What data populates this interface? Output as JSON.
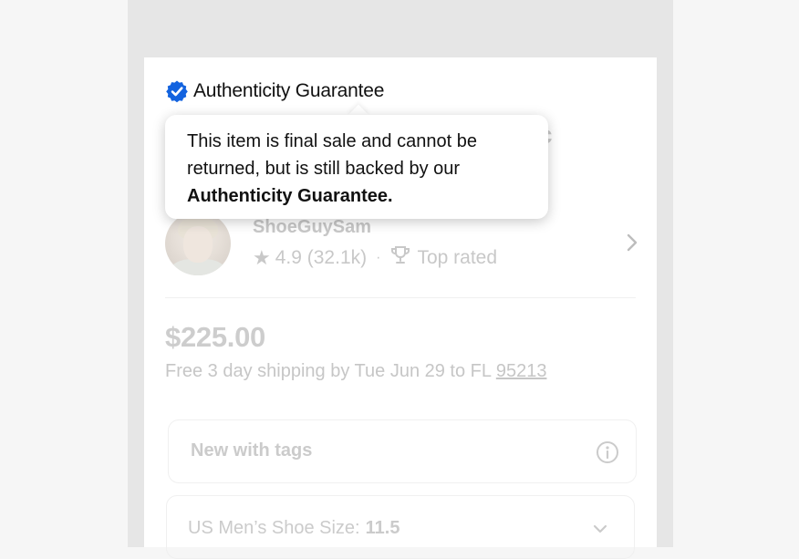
{
  "authenticity": {
    "label": "Authenticity Guarantee",
    "icon": "verified-badge-icon",
    "accent_color": "#1363df"
  },
  "tooltip": {
    "text_line1": "This item is final sale and cannot be returned, but is still backed by our",
    "text_bold": "Authenticity Guarantee."
  },
  "title_fragment": "c",
  "seller": {
    "name": "ShoeGuySam",
    "rating": "4.9 (32.1k)",
    "separator": "·",
    "badge": "Top rated",
    "icons": [
      "star-icon",
      "trophy-icon",
      "chevron-right-icon"
    ]
  },
  "price": "$225.00",
  "shipping": {
    "text": "Free 3 day shipping by Tue Jun 29 to FL",
    "zip": "95213"
  },
  "condition": {
    "label": "New with tags",
    "icon": "info-icon"
  },
  "size": {
    "label": "US Men’s Shoe Size:",
    "value": "11.5",
    "icon": "chevron-down-icon"
  }
}
